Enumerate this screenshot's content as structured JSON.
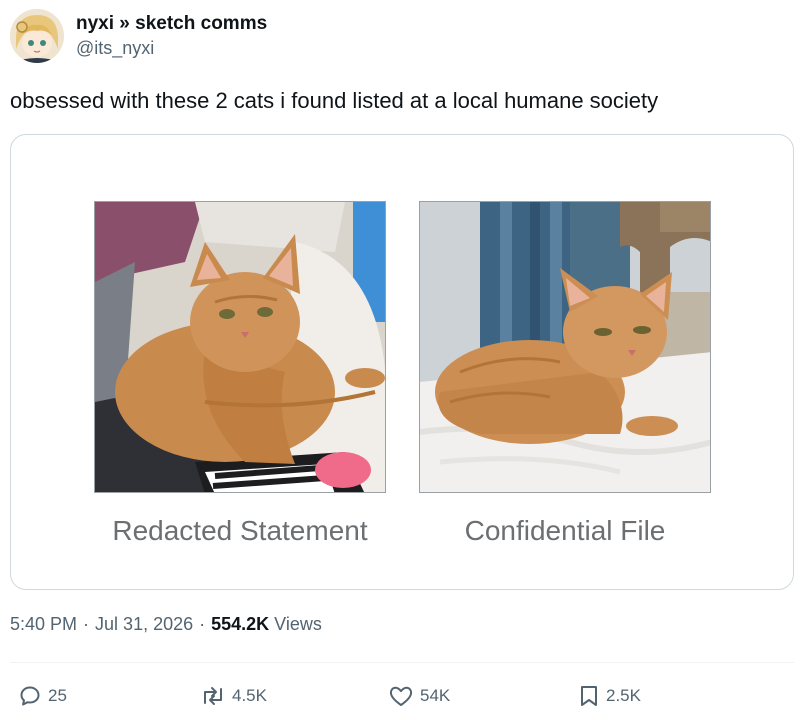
{
  "author": {
    "display_name": "nyxi » sketch comms",
    "handle": "@its_nyxi",
    "avatar_icon": "anime-avatar"
  },
  "tweet": {
    "text": "obsessed with these 2 cats i found listed at a local humane society"
  },
  "media": {
    "left": {
      "caption": "Redacted Statement",
      "image": "orange-cat-on-laundry-photo"
    },
    "right": {
      "caption": "Confidential File",
      "image": "orange-cat-on-white-rug-photo"
    }
  },
  "meta": {
    "time": "5:40 PM",
    "date": "Jul 31, 2026",
    "views_count": "554.2K",
    "views_label": "Views",
    "separator": "·"
  },
  "actions": {
    "reply": {
      "icon": "reply-icon",
      "count": "25"
    },
    "repost": {
      "icon": "repost-icon",
      "count": "4.5K"
    },
    "like": {
      "icon": "like-icon",
      "count": "54K"
    },
    "bookmark": {
      "icon": "bookmark-icon",
      "count": "2.5K"
    }
  },
  "colors": {
    "text": "#0f1419",
    "secondary": "#536471",
    "border": "#cfd9de"
  }
}
